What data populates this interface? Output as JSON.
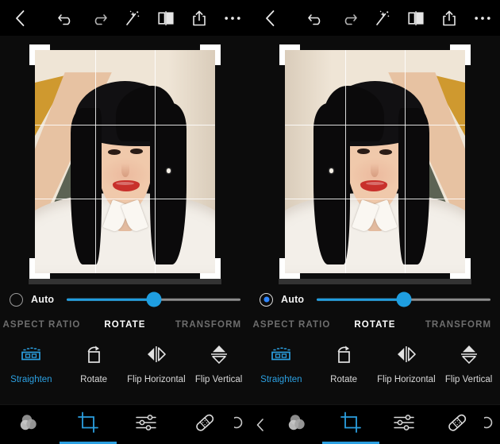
{
  "colors": {
    "accent": "#2b9fe0",
    "slider_fill": "#1f9ee0",
    "radio_dot": "#2f86ff",
    "background": "#0c0c0c",
    "bar_background": "#000000",
    "tab_inactive": "#6e6e6e",
    "tab_active": "#ffffff"
  },
  "panels": [
    {
      "id": "left-panel",
      "topbar": {
        "back_icon": "chevron-left-icon",
        "actions": [
          {
            "icon": "undo-icon",
            "name": "undo-button"
          },
          {
            "icon": "redo-icon",
            "name": "redo-button"
          },
          {
            "icon": "magic-wand-icon",
            "name": "auto-enhance-button"
          },
          {
            "icon": "compare-split-icon",
            "name": "before-after-button"
          },
          {
            "icon": "share-icon",
            "name": "share-button"
          },
          {
            "icon": "more-dots-icon",
            "name": "more-options-button"
          }
        ]
      },
      "photo": {
        "grid": "rule-of-thirds",
        "flipped": false,
        "handles": [
          "top-left",
          "top-right",
          "bottom-left",
          "bottom-right"
        ]
      },
      "auto": {
        "label": "Auto",
        "checked": false,
        "slider": {
          "value_percent": 50
        }
      },
      "tabs": [
        {
          "label": "ASPECT RATIO",
          "active": false
        },
        {
          "label": "ROTATE",
          "active": true
        },
        {
          "label": "TRANSFORM",
          "active": false
        }
      ],
      "tools": [
        {
          "label": "Straighten",
          "icon": "straighten-icon",
          "active": true
        },
        {
          "label": "Rotate",
          "icon": "rotate-icon",
          "active": false
        },
        {
          "label": "Flip Horizontal",
          "icon": "flip-horizontal-icon",
          "active": false
        },
        {
          "label": "Flip Vertical",
          "icon": "flip-vertical-icon",
          "active": false
        }
      ],
      "bottom_nav": {
        "leading_chevron": false,
        "items": [
          {
            "icon": "filters-icon",
            "name": "nav-filters",
            "active": false
          },
          {
            "icon": "crop-icon",
            "name": "nav-crop",
            "active": true
          },
          {
            "icon": "adjust-sliders-icon",
            "name": "nav-adjust",
            "active": false
          },
          {
            "icon": "healing-bandage-icon",
            "name": "nav-heal",
            "active": false
          }
        ],
        "trailing_partial_icon": "partial-icon"
      }
    },
    {
      "id": "right-panel",
      "topbar": {
        "back_icon": "chevron-left-icon",
        "actions": [
          {
            "icon": "undo-icon",
            "name": "undo-button"
          },
          {
            "icon": "redo-icon",
            "name": "redo-button"
          },
          {
            "icon": "magic-wand-icon",
            "name": "auto-enhance-button"
          },
          {
            "icon": "compare-split-icon",
            "name": "before-after-button"
          },
          {
            "icon": "share-icon",
            "name": "share-button"
          },
          {
            "icon": "more-dots-icon",
            "name": "more-options-button"
          }
        ]
      },
      "photo": {
        "grid": "rule-of-thirds",
        "flipped": true,
        "handles": [
          "top-left",
          "top-right",
          "bottom-left",
          "bottom-right"
        ]
      },
      "auto": {
        "label": "Auto",
        "checked": true,
        "slider": {
          "value_percent": 50
        }
      },
      "tabs": [
        {
          "label": "ASPECT RATIO",
          "active": false
        },
        {
          "label": "ROTATE",
          "active": true
        },
        {
          "label": "TRANSFORM",
          "active": false
        }
      ],
      "tools": [
        {
          "label": "Straighten",
          "icon": "straighten-icon",
          "active": true
        },
        {
          "label": "Rotate",
          "icon": "rotate-icon",
          "active": false
        },
        {
          "label": "Flip Horizontal",
          "icon": "flip-horizontal-icon",
          "active": false
        },
        {
          "label": "Flip Vertical",
          "icon": "flip-vertical-icon",
          "active": false
        }
      ],
      "bottom_nav": {
        "leading_chevron": true,
        "items": [
          {
            "icon": "filters-icon",
            "name": "nav-filters",
            "active": false
          },
          {
            "icon": "crop-icon",
            "name": "nav-crop",
            "active": true
          },
          {
            "icon": "adjust-sliders-icon",
            "name": "nav-adjust",
            "active": false
          },
          {
            "icon": "healing-bandage-icon",
            "name": "nav-heal",
            "active": false
          }
        ],
        "trailing_partial_icon": "partial-icon"
      }
    }
  ]
}
